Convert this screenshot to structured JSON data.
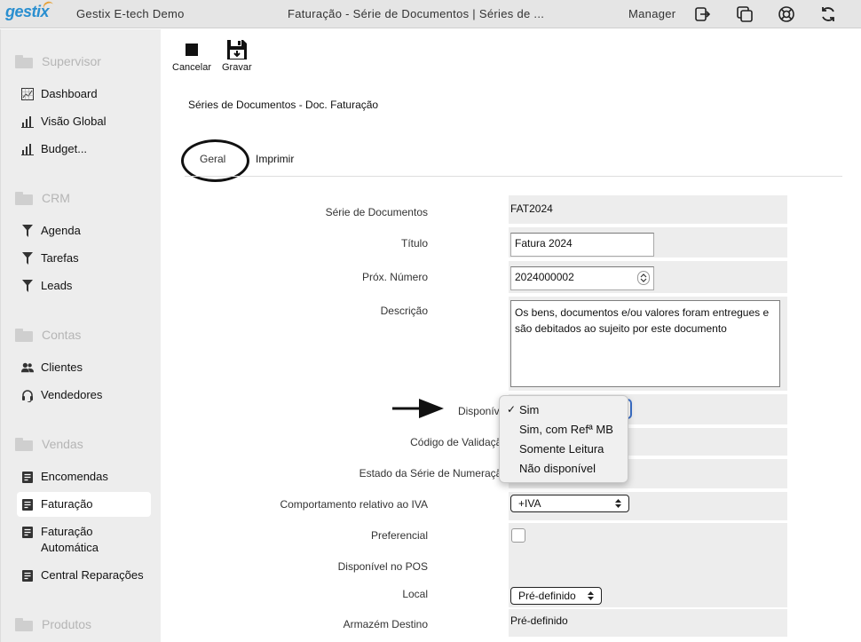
{
  "topbar": {
    "logo": "gestix",
    "app_name": "Gestix E-tech Demo",
    "window_title": "Faturação - Série de Documentos | Séries de ...",
    "user": "Manager",
    "icons": [
      "logout-icon",
      "windows-icon",
      "help-lifebuoy-icon",
      "refresh-icon"
    ]
  },
  "sidebar": {
    "sections": [
      {
        "label": "Supervisor",
        "items": [
          {
            "label": "Dashboard",
            "icon": "dashboard-icon"
          },
          {
            "label": "Visão Global",
            "icon": "bar-chart-icon"
          },
          {
            "label": "Budget...",
            "icon": "bar-chart-icon"
          }
        ]
      },
      {
        "label": "CRM",
        "items": [
          {
            "label": "Agenda",
            "icon": "funnel-icon"
          },
          {
            "label": "Tarefas",
            "icon": "funnel-icon"
          },
          {
            "label": "Leads",
            "icon": "funnel-icon"
          }
        ]
      },
      {
        "label": "Contas",
        "items": [
          {
            "label": "Clientes",
            "icon": "users-icon"
          },
          {
            "label": "Vendedores",
            "icon": "headset-icon"
          }
        ]
      },
      {
        "label": "Vendas",
        "items": [
          {
            "label": "Encomendas",
            "icon": "document-icon"
          },
          {
            "label": "Faturação",
            "icon": "document-icon",
            "active": true
          },
          {
            "label": "Faturação Automática",
            "icon": "document-icon"
          },
          {
            "label": "Central Reparações",
            "icon": "document-icon"
          }
        ]
      },
      {
        "label": "Produtos",
        "items": []
      }
    ]
  },
  "toolbar": {
    "cancel_label": "Cancelar",
    "save_label": "Gravar"
  },
  "page_title": "Séries de Documentos - Doc. Faturação",
  "tabs": [
    {
      "label": "Geral",
      "active": true
    },
    {
      "label": "Imprimir"
    }
  ],
  "form": {
    "serie_label": "Série de Documentos",
    "serie_value": "FAT2024",
    "titulo_label": "Título",
    "titulo_value": "Fatura 2024",
    "prox_numero_label": "Próx. Número",
    "prox_numero_value": "2024000002",
    "descricao_label": "Descrição",
    "descricao_value": "Os bens, documentos e/ou valores foram entregues e são debitados ao sujeito por este documento",
    "disponivel_label": "Disponível",
    "codigo_validacao_label": "Código de Validação",
    "estado_serie_label": "Estado da Série de Numeração",
    "iva_label": "Comportamento relativo ao IVA",
    "iva_value": "+IVA",
    "preferencial_label": "Preferencial",
    "preferencial_checked": false,
    "pos_label": "Disponível no POS",
    "local_label": "Local",
    "local_value": "Pré-definido",
    "armazem_label": "Armazém Destino",
    "armazem_value": "Pré-definido"
  },
  "dropdown": {
    "options": [
      "Sim",
      "Sim, com Refª MB",
      "Somente Leitura",
      "Não disponível"
    ],
    "selected": "Sim"
  },
  "colors": {
    "logo_blue": "#2a8fd0",
    "sidebar_bg": "#ededed",
    "focus_blue": "#3b6fc8"
  }
}
